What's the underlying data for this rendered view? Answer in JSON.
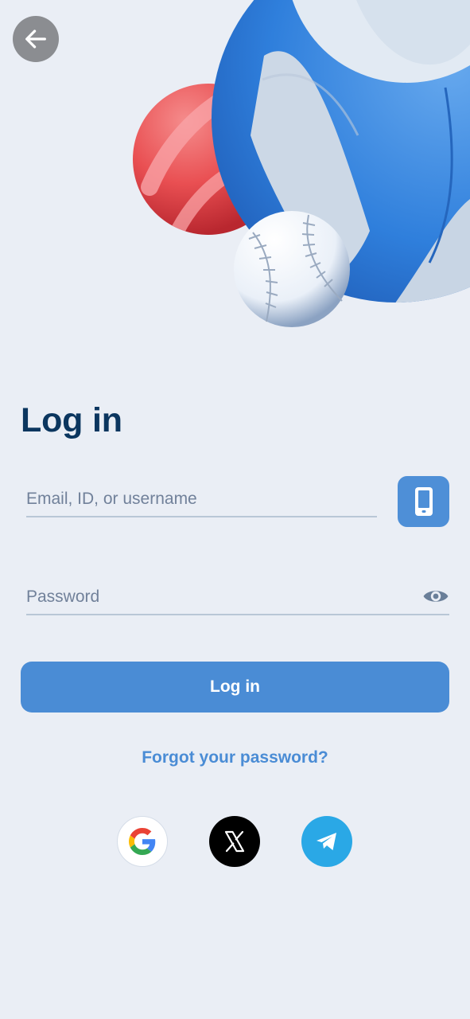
{
  "header": {
    "back_label": "Back"
  },
  "login": {
    "title": "Log in",
    "email_placeholder": "Email, ID, or username",
    "password_placeholder": "Password",
    "submit_label": "Log in",
    "forgot_password": "Forgot your password?"
  },
  "social": {
    "providers": [
      {
        "name": "Google",
        "icon": "google-icon"
      },
      {
        "name": "X",
        "icon": "x-icon"
      },
      {
        "name": "Telegram",
        "icon": "telegram-icon"
      }
    ]
  },
  "colors": {
    "background": "#eaeef5",
    "title": "#0b365f",
    "accent": "#4a8cd5",
    "input_line": "#b9c7d6"
  }
}
